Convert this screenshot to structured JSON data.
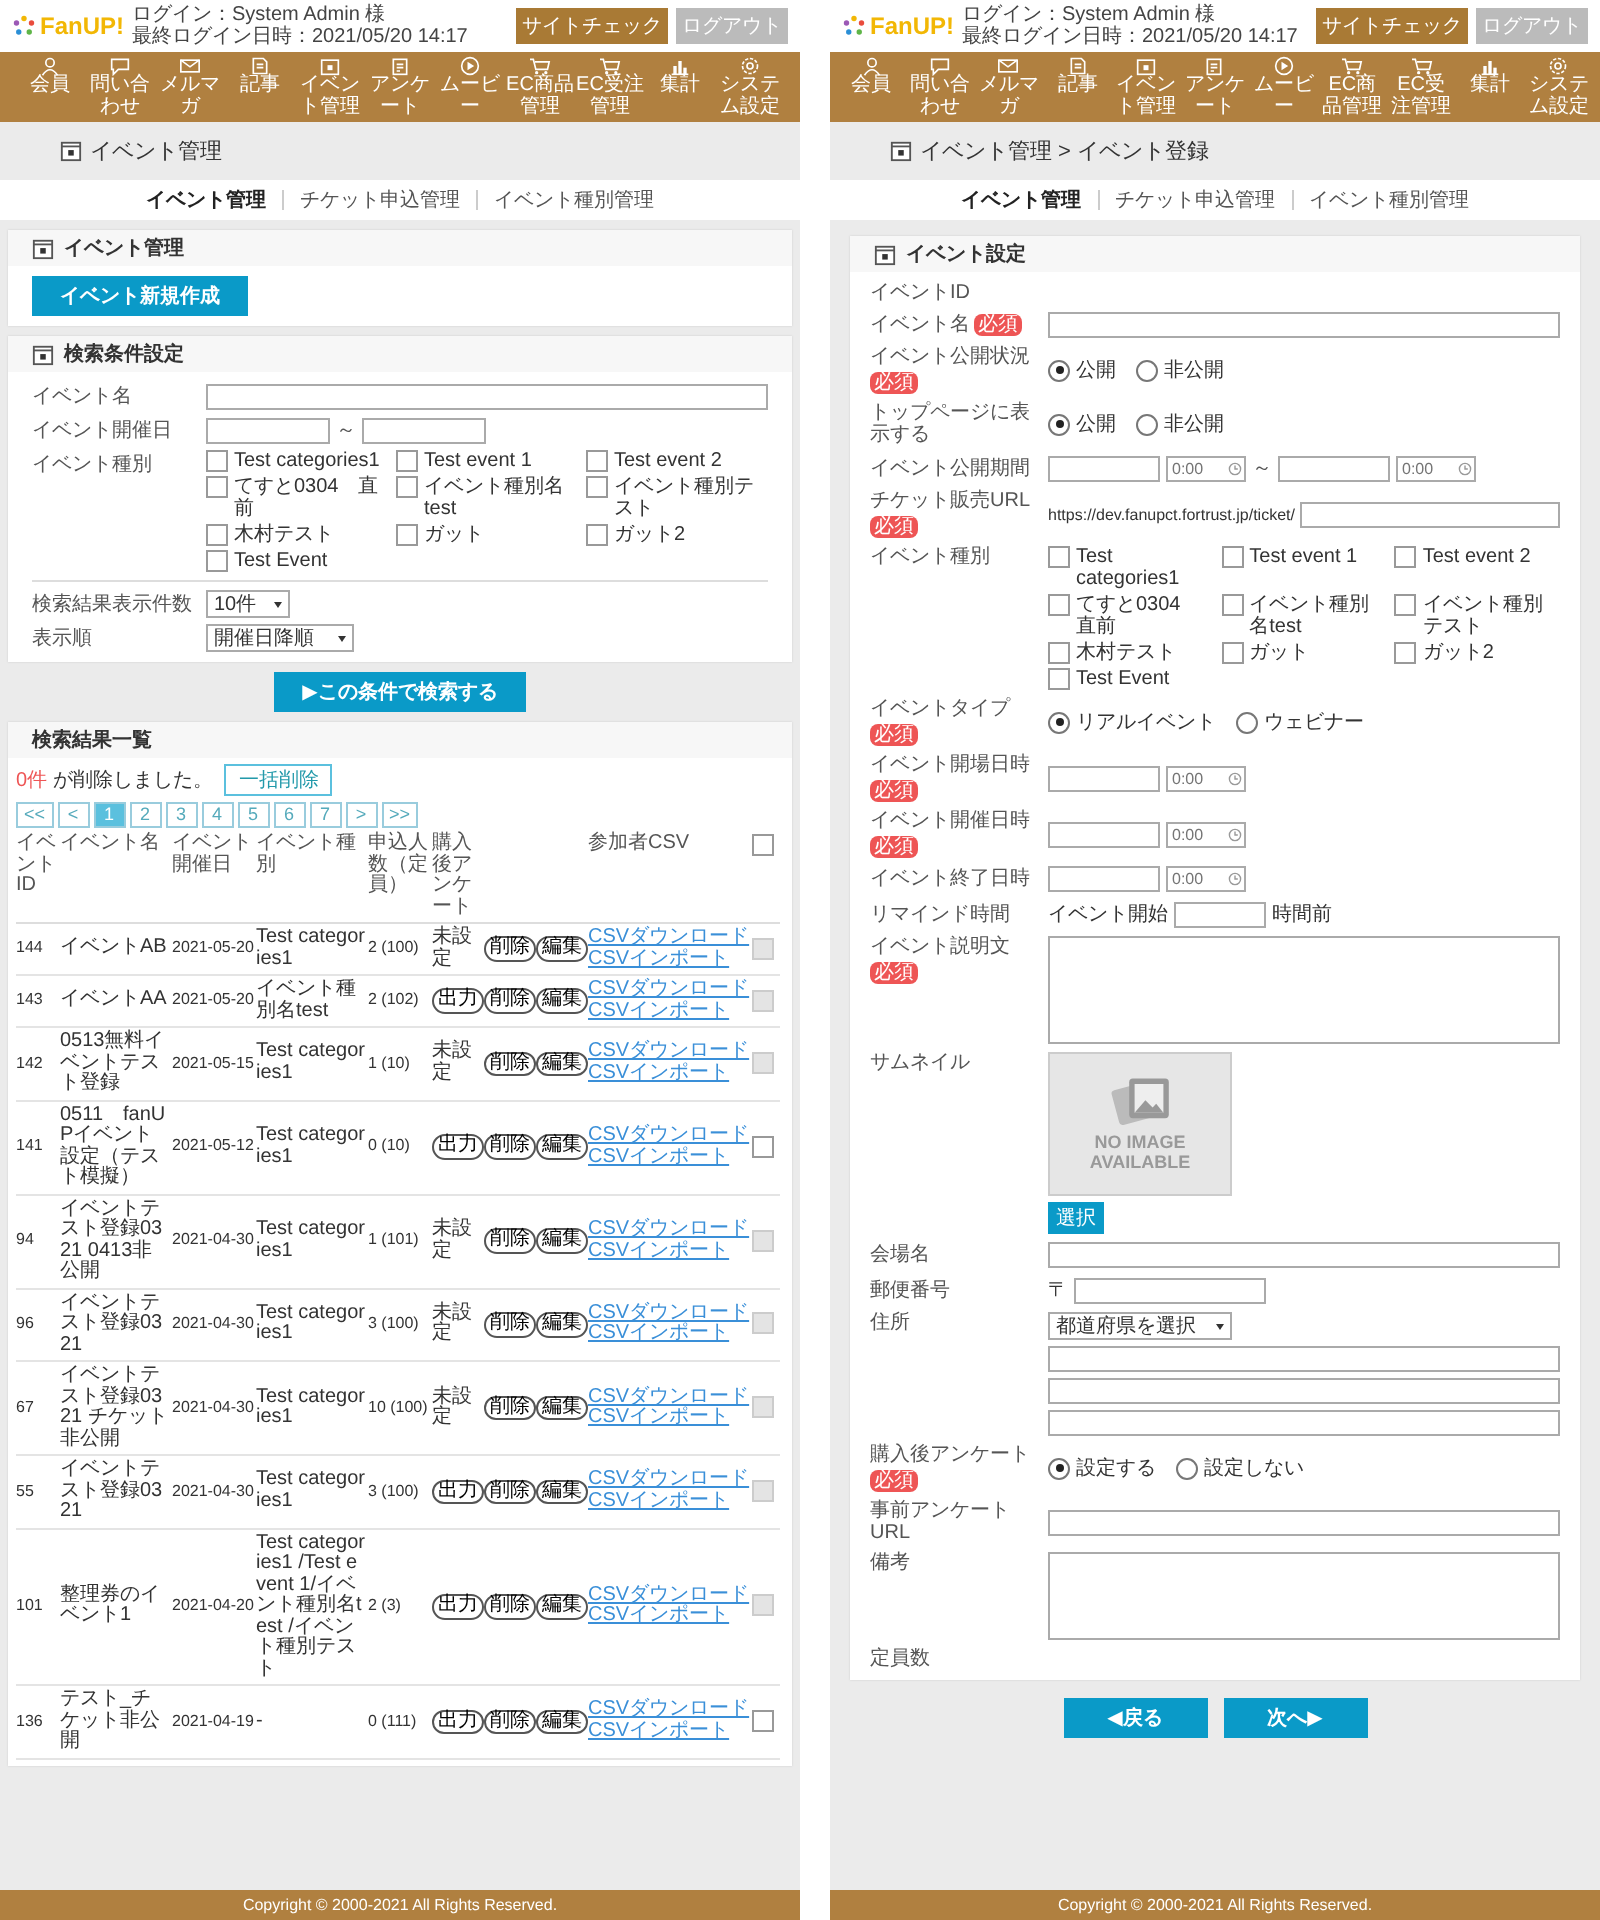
{
  "screens": [
    {
      "header": {
        "logo": "FanUP!",
        "login_user": "ログイン：System Admin 様",
        "last_login": "最終ログイン日時：2021/05/20 14:17",
        "site_check": "サイトチェック",
        "logout": "ログアウト"
      },
      "nav": [
        "会員",
        "問い合わせ",
        "メルマガ",
        "記事",
        "イベント管理",
        "アンケート",
        "ムービー",
        "EC商品管理",
        "EC受注管理",
        "集計",
        "システム設定"
      ],
      "page_title": "イベント管理",
      "subnav": [
        {
          "label": "イベント管理",
          "selected": true
        },
        {
          "label": "チケット申込管理",
          "selected": false
        },
        {
          "label": "イベント種別管理",
          "selected": false
        }
      ],
      "event_card": {
        "title": "イベント管理",
        "create_button": "イベント新規作成"
      },
      "search_card": {
        "title": "検索条件設定",
        "name_label": "イベント名",
        "date_label": "イベント開催日",
        "range_sep": "～",
        "type_label": "イベント種別",
        "types": [
          {
            "label": "Test categories1",
            "checked": false
          },
          {
            "label": "Test event 1",
            "checked": false
          },
          {
            "label": "Test event 2",
            "checked": false
          },
          {
            "label": "てすと0304　直前",
            "checked": false
          },
          {
            "label": "イベント種別名test",
            "checked": false
          },
          {
            "label": "イベント種別テスト",
            "checked": false
          },
          {
            "label": "木村テスト",
            "checked": false
          },
          {
            "label": "ガット",
            "checked": false
          },
          {
            "label": "ガット2",
            "checked": false
          },
          {
            "label": "Test Event",
            "checked": false
          }
        ],
        "count_label": "検索結果表示件数",
        "count_value": "10件",
        "order_label": "表示順",
        "order_value": "開催日降順"
      },
      "search_button": "▶この条件で検索する",
      "results": {
        "title": "検索結果一覧",
        "deleted_count": "0件",
        "deleted_text": "が削除しました。",
        "bulk_delete": "一括削除",
        "pages": [
          {
            "label": "<<",
            "selected": false
          },
          {
            "label": "<",
            "selected": false
          },
          {
            "label": "1",
            "selected": true
          },
          {
            "label": "2",
            "selected": false
          },
          {
            "label": "3",
            "selected": false
          },
          {
            "label": "4",
            "selected": false
          },
          {
            "label": "5",
            "selected": false
          },
          {
            "label": "6",
            "selected": false
          },
          {
            "label": "7",
            "selected": false
          },
          {
            "label": ">",
            "selected": false
          },
          {
            "label": ">>",
            "selected": false
          }
        ],
        "columns": [
          "イベントID",
          "イベント名",
          "イベント開催日",
          "イベント種別",
          "申込人数（定員）",
          "購入後アンケート",
          "参加者CSV"
        ],
        "header_checked": false,
        "rows": [
          {
            "id": "144",
            "name": "イベントAB",
            "date": "2021-05-20",
            "type": "Test categories1",
            "count": "2 (100)",
            "survey": {
              "kind": "text",
              "label": "未設定"
            },
            "delete": "削除",
            "edit": "編集",
            "csv_download": "CSVダウンロード",
            "csv_import": "CSVインポート",
            "disabled": true
          },
          {
            "id": "143",
            "name": "イベントAA",
            "date": "2021-05-20",
            "type": "イベント種別名test",
            "count": "2 (102)",
            "survey": {
              "kind": "button",
              "label": "出力"
            },
            "delete": "削除",
            "edit": "編集",
            "csv_download": "CSVダウンロード",
            "csv_import": "CSVインポート",
            "disabled": true
          },
          {
            "id": "142",
            "name": "0513無料イベントテスト登録",
            "date": "2021-05-15",
            "type": "Test categories1",
            "count": "1 (10)",
            "survey": {
              "kind": "text",
              "label": "未設定"
            },
            "delete": "削除",
            "edit": "編集",
            "csv_download": "CSVダウンロード",
            "csv_import": "CSVインポート",
            "disabled": true
          },
          {
            "id": "141",
            "name": "0511　fanUPイベント設定（テスト模擬）",
            "date": "2021-05-12",
            "type": "Test categories1",
            "count": "0 (10)",
            "survey": {
              "kind": "button",
              "label": "出力"
            },
            "delete": "削除",
            "edit": "編集",
            "csv_download": "CSVダウンロード",
            "csv_import": "CSVインポート",
            "disabled": false
          },
          {
            "id": "94",
            "name": "イベントテスト登録0321 0413非公開",
            "date": "2021-04-30",
            "type": "Test categories1",
            "count": "1 (101)",
            "survey": {
              "kind": "text",
              "label": "未設定"
            },
            "delete": "削除",
            "edit": "編集",
            "csv_download": "CSVダウンロード",
            "csv_import": "CSVインポート",
            "disabled": true
          },
          {
            "id": "96",
            "name": "イベントテスト登録0321",
            "date": "2021-04-30",
            "type": "Test categories1",
            "count": "3 (100)",
            "survey": {
              "kind": "text",
              "label": "未設定"
            },
            "delete": "削除",
            "edit": "編集",
            "csv_download": "CSVダウンロード",
            "csv_import": "CSVインポート",
            "disabled": true
          },
          {
            "id": "67",
            "name": "イベントテスト登録0321 チケット非公開",
            "date": "2021-04-30",
            "type": "Test categories1",
            "count": "10 (100)",
            "survey": {
              "kind": "text",
              "label": "未設定"
            },
            "delete": "削除",
            "edit": "編集",
            "csv_download": "CSVダウンロード",
            "csv_import": "CSVインポート",
            "disabled": true
          },
          {
            "id": "55",
            "name": "イベントテスト登録0321",
            "date": "2021-04-30",
            "type": "Test categories1",
            "count": "3 (100)",
            "survey": {
              "kind": "button",
              "label": "出力"
            },
            "delete": "削除",
            "edit": "編集",
            "csv_download": "CSVダウンロード",
            "csv_import": "CSVインポート",
            "disabled": true
          },
          {
            "id": "101",
            "name": "整理券のイベント1",
            "date": "2021-04-20",
            "type": "Test categories1 /Test event 1/イベント種別名test /イベント種別テスト",
            "count": "2 (3)",
            "survey": {
              "kind": "button",
              "label": "出力"
            },
            "delete": "削除",
            "edit": "編集",
            "csv_download": "CSVダウンロード",
            "csv_import": "CSVインポート",
            "disabled": true
          },
          {
            "id": "136",
            "name": "テスト_チケット非公開",
            "date": "2021-04-19",
            "type": "-",
            "count": "0 (111)",
            "survey": {
              "kind": "button",
              "label": "出力"
            },
            "delete": "削除",
            "edit": "編集",
            "csv_download": "CSVダウンロード",
            "csv_import": "CSVインポート",
            "disabled": false
          }
        ]
      },
      "footer": "Copyright © 2000-2021 All Rights Reserved."
    },
    {
      "header": {
        "logo": "FanUP!",
        "login_user": "ログイン：System Admin 様",
        "last_login": "最終ログイン日時：2021/05/20 14:17",
        "site_check": "サイトチェック",
        "logout": "ログアウト"
      },
      "nav": [
        "会員",
        "問い合わせ",
        "メルマガ",
        "記事",
        "イベント管理",
        "アンケート",
        "ムービー",
        "EC商品管理",
        "EC受注管理",
        "集計",
        "システム設定"
      ],
      "page_title": "イベント管理 > イベント登録",
      "subnav": [
        {
          "label": "イベント管理",
          "selected": true
        },
        {
          "label": "チケット申込管理",
          "selected": false
        },
        {
          "label": "イベント種別管理",
          "selected": false
        }
      ],
      "form": {
        "title": "イベント設定",
        "fields": [
          {
            "kind": "text",
            "label": "イベントID"
          },
          {
            "kind": "input",
            "label": "イベント名",
            "badge": "必須"
          },
          {
            "kind": "radio",
            "label": "イベント公開状況",
            "badge": "必須",
            "options": [
              {
                "label": "公開",
                "selected": true
              },
              {
                "label": "非公開",
                "selected": false
              }
            ]
          },
          {
            "kind": "radio",
            "label": "トップページに表示する",
            "options": [
              {
                "label": "公開",
                "selected": true
              },
              {
                "label": "非公開",
                "selected": false
              }
            ]
          },
          {
            "kind": "period",
            "label": "イベント公開期間",
            "start_placeholder": "0:00",
            "range_sep": "～",
            "end_placeholder": "0:00"
          },
          {
            "kind": "url",
            "label": "チケット販売URL",
            "badge": "必須",
            "prefix": "https://dev.fanupct.fortrust.jp/ticket/"
          },
          {
            "kind": "checks",
            "label": "イベント種別",
            "options": [
              {
                "label": "Test categories1",
                "checked": false
              },
              {
                "label": "Test event 1",
                "checked": false
              },
              {
                "label": "Test event 2",
                "checked": false
              },
              {
                "label": "てすと0304　直前",
                "checked": false
              },
              {
                "label": "イベント種別名test",
                "checked": false
              },
              {
                "label": "イベント種別テスト",
                "checked": false
              },
              {
                "label": "木村テスト",
                "checked": false
              },
              {
                "label": "ガット",
                "checked": false
              },
              {
                "label": "ガット2",
                "checked": false
              },
              {
                "label": "Test Event",
                "checked": false
              }
            ]
          },
          {
            "kind": "radio",
            "label": "イベントタイプ",
            "badge": "必須",
            "options": [
              {
                "label": "リアルイベント",
                "selected": true
              },
              {
                "label": "ウェビナー",
                "selected": false
              }
            ]
          },
          {
            "kind": "datetime",
            "label": "イベント開場日時",
            "badge": "必須",
            "placeholder": "0:00"
          },
          {
            "kind": "datetime",
            "label": "イベント開催日時",
            "badge": "必須",
            "placeholder": "0:00"
          },
          {
            "kind": "datetime",
            "label": "イベント終了日時",
            "placeholder": "0:00"
          },
          {
            "kind": "remind",
            "label": "リマインド時間",
            "prefix": "イベント開始",
            "suffix": "時間前"
          },
          {
            "kind": "textarea",
            "label": "イベント説明文",
            "badge": "必須"
          },
          {
            "kind": "image",
            "label": "サムネイル",
            "image_text": "NO IMAGE AVAILABLE",
            "button": "選択"
          },
          {
            "kind": "input",
            "label": "会場名"
          },
          {
            "kind": "postal",
            "label": "郵便番号",
            "prefix": "〒"
          },
          {
            "kind": "address",
            "label": "住所",
            "select": "都道府県を選択"
          },
          {
            "kind": "radio",
            "label": "購入後アンケート",
            "badge": "必須",
            "options": [
              {
                "label": "設定する",
                "selected": true
              },
              {
                "label": "設定しない",
                "selected": false
              }
            ]
          },
          {
            "kind": "input",
            "label": "事前アンケートURL"
          },
          {
            "kind": "textarea",
            "label": "備考"
          },
          {
            "kind": "text",
            "label": "定員数"
          }
        ]
      },
      "back_button": "◀戻る",
      "next_button": "次へ▶",
      "footer": "Copyright © 2000-2021 All Rights Reserved."
    }
  ]
}
